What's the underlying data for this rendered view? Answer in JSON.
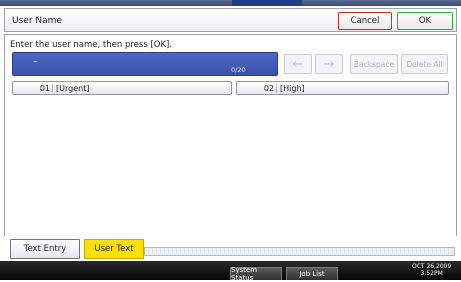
{
  "header": {
    "title": "User Name",
    "cancel_label": "Cancel",
    "ok_label": "OK"
  },
  "main": {
    "prompt": "Enter the user name, then press [OK].",
    "input": {
      "value": "–",
      "counter": "0/20"
    },
    "controls": {
      "left_arrow": "←",
      "right_arrow": "→",
      "backspace_label": "Backspace",
      "delete_all_label": "Delete All"
    },
    "slots": [
      {
        "number": "01",
        "name": "[Urgent]"
      },
      {
        "number": "02",
        "name": "[High]"
      }
    ]
  },
  "tabs": {
    "text_entry": "Text Entry",
    "user_text": "User Text"
  },
  "statusbar": {
    "system_status": "System Status",
    "job_list": "Job List",
    "date": "OCT  26,2009",
    "time": "3:52PM"
  },
  "colors": {
    "entry_field": "#3a50ad",
    "cancel_border": "#c8321c",
    "ok_border": "#3aa833",
    "user_text_tab": "#ffe000",
    "status_bar": "#050505"
  }
}
